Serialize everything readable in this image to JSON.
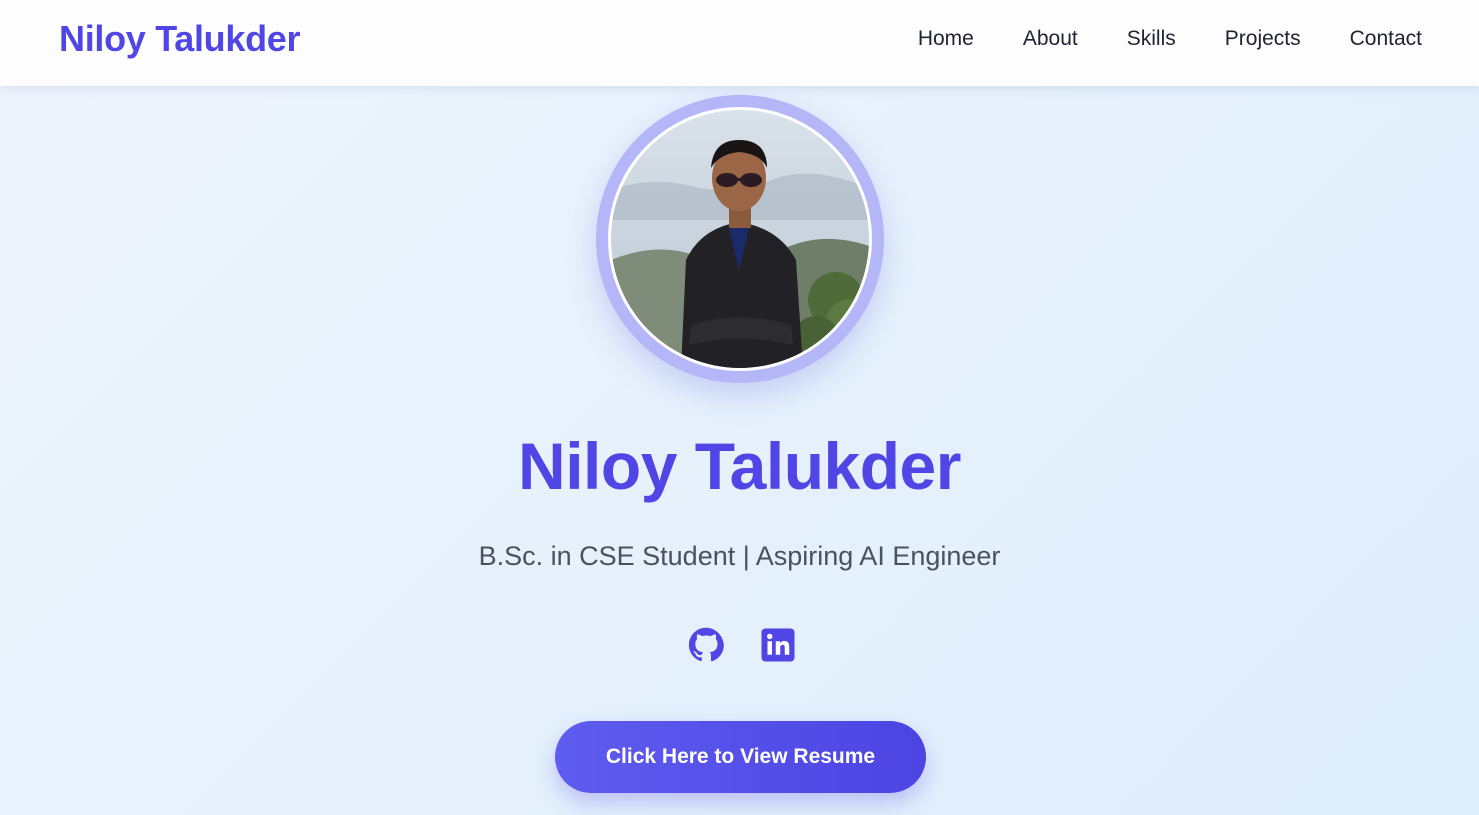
{
  "nav": {
    "brand": "Niloy Talukder",
    "links": [
      {
        "label": "Home"
      },
      {
        "label": "About"
      },
      {
        "label": "Skills"
      },
      {
        "label": "Projects"
      },
      {
        "label": "Contact"
      }
    ]
  },
  "hero": {
    "name": "Niloy Talukder",
    "subtitle": "B.Sc. in CSE Student | Aspiring AI Engineer",
    "social": [
      {
        "icon": "github-icon"
      },
      {
        "icon": "linkedin-icon"
      }
    ],
    "resume_button": "Click Here to View Resume"
  },
  "colors": {
    "accent": "#5046e5",
    "ring": "#b4b6f8",
    "nav_text": "#1f2433",
    "subtitle_text": "#4a5260"
  }
}
